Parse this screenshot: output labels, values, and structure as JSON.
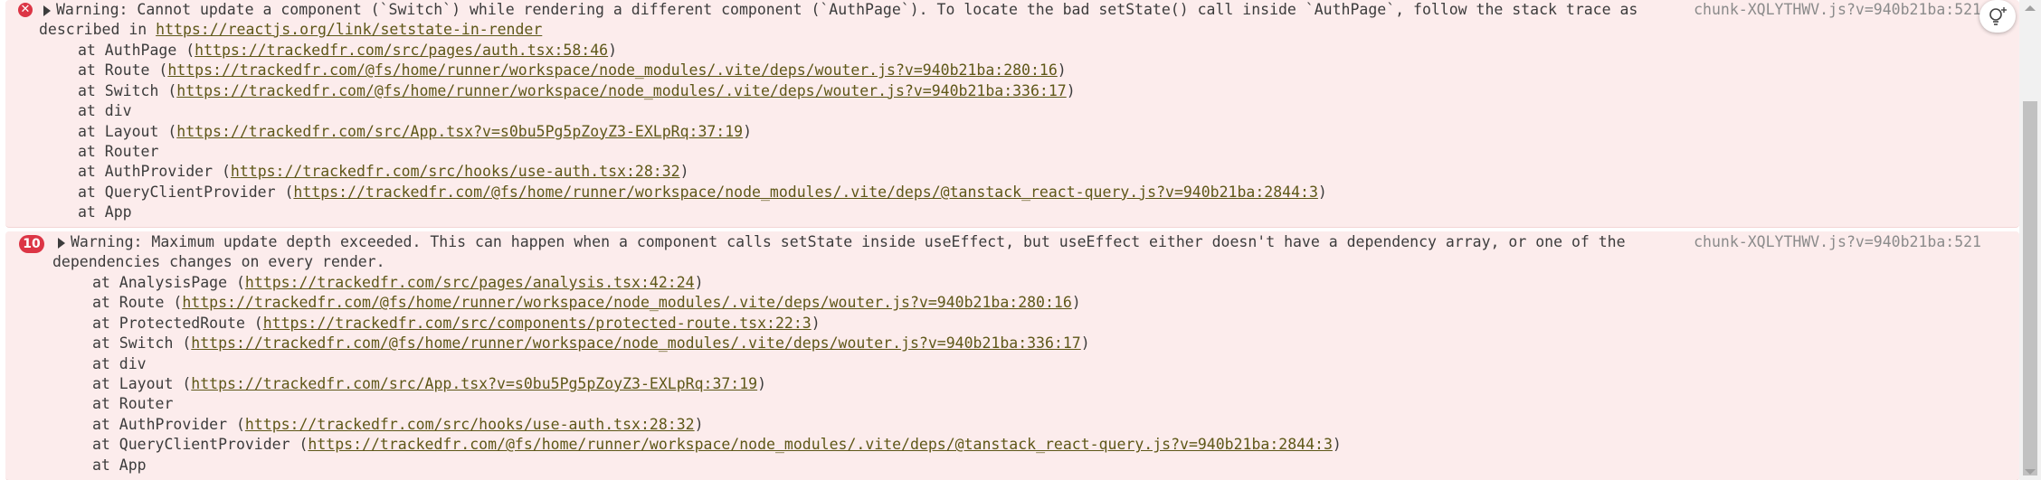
{
  "messages": [
    {
      "level": "error",
      "source": "chunk-XQLYTHWV.js?v=940b21ba:521",
      "text1": "Warning: Cannot update a component (`Switch`) while rendering a different component (`AuthPage`). To locate the bad setState() call inside `AuthPage`, follow the stack trace as",
      "text2_prefix": "described in ",
      "text2_link": "https://reactjs.org/link/setstate-in-render",
      "frames": [
        {
          "name": "at AuthPage (",
          "link": "https://trackedfr.com/src/pages/auth.tsx:58:46",
          "suffix": ")"
        },
        {
          "name": "at Route (",
          "link": "https://trackedfr.com/@fs/home/runner/workspace/node_modules/.vite/deps/wouter.js?v=940b21ba:280:16",
          "suffix": ")"
        },
        {
          "name": "at Switch (",
          "link": "https://trackedfr.com/@fs/home/runner/workspace/node_modules/.vite/deps/wouter.js?v=940b21ba:336:17",
          "suffix": ")"
        },
        {
          "name": "at div",
          "link": "",
          "suffix": ""
        },
        {
          "name": "at Layout (",
          "link": "https://trackedfr.com/src/App.tsx?v=s0bu5Pg5pZoyZ3-EXLpRq:37:19",
          "suffix": ")"
        },
        {
          "name": "at Router",
          "link": "",
          "suffix": ""
        },
        {
          "name": "at AuthProvider (",
          "link": "https://trackedfr.com/src/hooks/use-auth.tsx:28:32",
          "suffix": ")"
        },
        {
          "name": "at QueryClientProvider (",
          "link": "https://trackedfr.com/@fs/home/runner/workspace/node_modules/.vite/deps/@tanstack_react-query.js?v=940b21ba:2844:3",
          "suffix": ")"
        },
        {
          "name": "at App",
          "link": "",
          "suffix": ""
        }
      ]
    },
    {
      "level": "error",
      "count": "10",
      "source": "chunk-XQLYTHWV.js?v=940b21ba:521",
      "text1": "Warning: Maximum update depth exceeded. This can happen when a component calls setState inside useEffect, but useEffect either doesn't have a dependency array, or one of the",
      "text2_prefix": "dependencies changes on every render.",
      "text2_link": "",
      "frames": [
        {
          "name": "at AnalysisPage (",
          "link": "https://trackedfr.com/src/pages/analysis.tsx:42:24",
          "suffix": ")"
        },
        {
          "name": "at Route (",
          "link": "https://trackedfr.com/@fs/home/runner/workspace/node_modules/.vite/deps/wouter.js?v=940b21ba:280:16",
          "suffix": ")"
        },
        {
          "name": "at ProtectedRoute (",
          "link": "https://trackedfr.com/src/components/protected-route.tsx:22:3",
          "suffix": ")"
        },
        {
          "name": "at Switch (",
          "link": "https://trackedfr.com/@fs/home/runner/workspace/node_modules/.vite/deps/wouter.js?v=940b21ba:336:17",
          "suffix": ")"
        },
        {
          "name": "at div",
          "link": "",
          "suffix": ""
        },
        {
          "name": "at Layout (",
          "link": "https://trackedfr.com/src/App.tsx?v=s0bu5Pg5pZoyZ3-EXLpRq:37:19",
          "suffix": ")"
        },
        {
          "name": "at Router",
          "link": "",
          "suffix": ""
        },
        {
          "name": "at AuthProvider (",
          "link": "https://trackedfr.com/src/hooks/use-auth.tsx:28:32",
          "suffix": ")"
        },
        {
          "name": "at QueryClientProvider (",
          "link": "https://trackedfr.com/@fs/home/runner/workspace/node_modules/.vite/deps/@tanstack_react-query.js?v=940b21ba:2844:3",
          "suffix": ")"
        },
        {
          "name": "at App",
          "link": "",
          "suffix": ""
        }
      ]
    }
  ],
  "icons": {
    "error": "x-circle-icon",
    "expand": "triangle-right-icon",
    "insights": "lightbulb-sparkle-icon"
  },
  "colors": {
    "error_bg": "#fcecec",
    "error_red": "#dc3545",
    "link": "#5e5718",
    "source": "#8b8b8b"
  }
}
